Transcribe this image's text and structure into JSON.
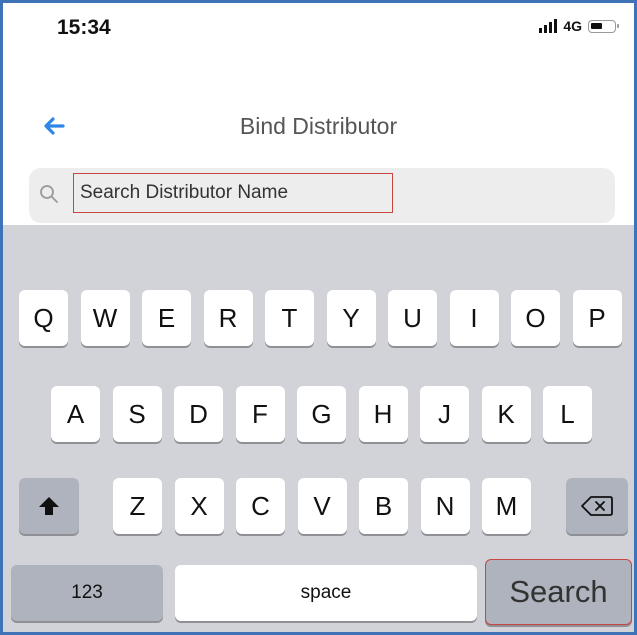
{
  "status_bar": {
    "time": "15:34",
    "network": "4G",
    "signal_icon": "signal-bars-icon",
    "battery_icon": "battery-icon"
  },
  "nav": {
    "back_icon": "arrow-left-icon",
    "title": "Bind Distributor",
    "accent_color": "#2f86e6"
  },
  "search": {
    "icon": "search-icon",
    "placeholder": "Search Distributor Name",
    "value": ""
  },
  "keyboard": {
    "row1": [
      "Q",
      "W",
      "E",
      "R",
      "T",
      "Y",
      "U",
      "I",
      "O",
      "P"
    ],
    "row2": [
      "A",
      "S",
      "D",
      "F",
      "G",
      "H",
      "J",
      "K",
      "L"
    ],
    "row3": [
      "Z",
      "X",
      "C",
      "V",
      "B",
      "N",
      "M"
    ],
    "shift_icon": "shift-arrow-icon",
    "delete_icon": "backspace-icon",
    "numbers_label": "123",
    "space_label": "space",
    "return_label": "Search"
  }
}
